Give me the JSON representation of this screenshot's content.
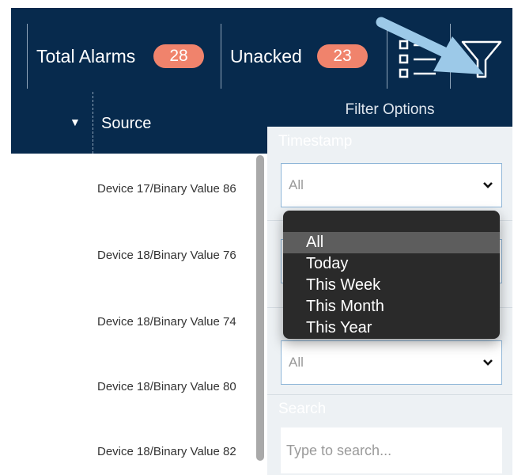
{
  "header": {
    "total_alarms_label": "Total Alarms",
    "total_alarms_count": "28",
    "unacked_label": "Unacked",
    "unacked_count": "23"
  },
  "icons": {
    "list": "list-settings-icon",
    "filter": "filter-icon",
    "sort": "sort-down-icon",
    "select_chevron": "chevron-down-icon"
  },
  "table": {
    "sort_glyph": "▼",
    "column_title": "Source",
    "rows": [
      "Device 17/Binary Value 86",
      "Device 18/Binary Value 76",
      "Device 18/Binary Value 74",
      "Device 18/Binary Value 80",
      "Device 18/Binary Value 82"
    ]
  },
  "filter_panel": {
    "title": "Filter Options",
    "timestamp_label": "Timestamp",
    "timestamp_value": "All",
    "second_value": "All",
    "search_label": "Search",
    "search_placeholder": "Type to search..."
  },
  "dropdown": {
    "options": [
      "All",
      "Today",
      "This Week",
      "This Month",
      "This Year"
    ],
    "selected": "All"
  },
  "colors": {
    "header_bg": "#072a4d",
    "badge": "#f0836c",
    "panel_bg": "#edf1f4",
    "dropdown_bg": "#2a2a2a",
    "dropdown_selected": "#5d5d5d",
    "select_border": "#8fb6d8",
    "arrow": "#9cc9e8"
  }
}
